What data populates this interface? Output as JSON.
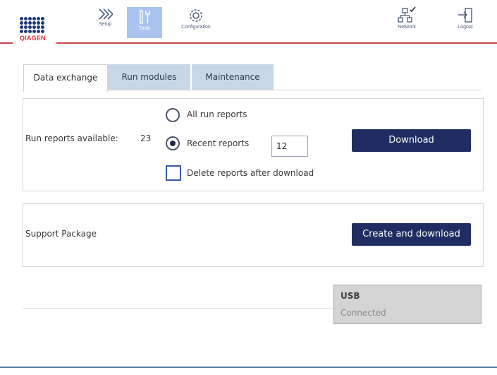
{
  "brand": {
    "name": "QIAGEN",
    "logo_color": "#1f3a7a",
    "accent": "#d9414f"
  },
  "nav": {
    "setup": {
      "label": "Setup",
      "icon": "double-chevron-right-icon"
    },
    "tools": {
      "label": "Tools",
      "icon": "tools-icon",
      "active": true
    },
    "configuration": {
      "label": "Configuration",
      "icon": "gear-icon"
    },
    "network": {
      "label": "Network",
      "icon": "network-icon"
    },
    "logout": {
      "label": "Logout",
      "icon": "logout-icon"
    }
  },
  "tabs": [
    {
      "label": "Data exchange",
      "active": true
    },
    {
      "label": "Run modules",
      "active": false
    },
    {
      "label": "Maintenance",
      "active": false
    }
  ],
  "run_reports": {
    "label": "Run reports available:",
    "count": "23",
    "option_all": "All run reports",
    "option_recent": "Recent reports",
    "selected": "recent",
    "recent_value": "12",
    "delete_label": "Delete reports after download",
    "delete_checked": false,
    "download_label": "Download"
  },
  "support": {
    "label": "Support Package",
    "button_label": "Create and download"
  },
  "usb": {
    "title": "USB",
    "status": "Connected"
  },
  "colors": {
    "primary_button": "#1f2d63",
    "active_tab_bg": "#ffffff",
    "inactive_tab_bg": "#c9d6e5",
    "nav_active_bg": "#a9c4ee"
  }
}
